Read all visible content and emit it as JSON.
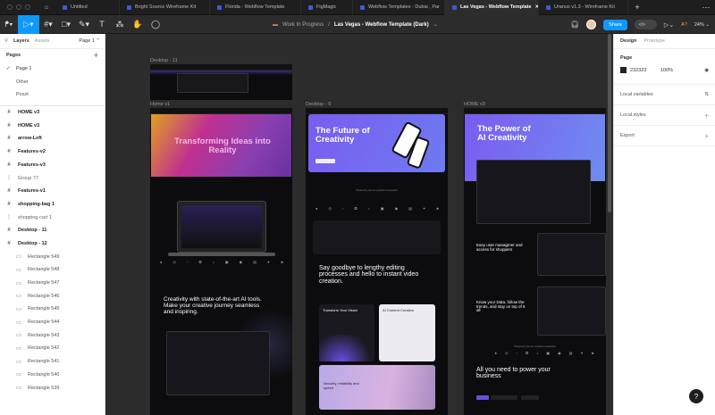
{
  "tabs": [
    {
      "label": "Untitled",
      "active": false
    },
    {
      "label": "Bright Source Wireframe Kit",
      "active": false
    },
    {
      "label": "Florida - Webflow Template",
      "active": false
    },
    {
      "label": "FigMagic",
      "active": false
    },
    {
      "label": "Webflow Templates - Dubai , Par",
      "active": false
    },
    {
      "label": "Las Vegas - Webflow Template",
      "active": true
    },
    {
      "label": "Uranus v1.3 - Wireframe Kit",
      "active": false
    }
  ],
  "toolbar": {
    "project": "Work In Progress",
    "separator": "/",
    "file": "Las Vegas - Webflow Template (Dark)",
    "share": "Share",
    "zoom": "24%",
    "dev_mode": "</>",
    "warning": "A?"
  },
  "left_panel": {
    "tabs": [
      "Layers",
      "Assets"
    ],
    "page_selector": "Page 1",
    "pages_title": "Pages",
    "pages": [
      "Page 1",
      "Other",
      "Poszt"
    ],
    "layers": [
      {
        "name": "HOME v3",
        "type": "frame"
      },
      {
        "name": "HOME v3",
        "type": "frame"
      },
      {
        "name": "arrow-Left",
        "type": "frame"
      },
      {
        "name": "Features-v2",
        "type": "frame"
      },
      {
        "name": "Features-v3",
        "type": "frame"
      },
      {
        "name": "Group 77",
        "type": "group"
      },
      {
        "name": "Features-v1",
        "type": "frame"
      },
      {
        "name": "shopping-bag 1",
        "type": "frame"
      },
      {
        "name": "shopping-cart 1",
        "type": "group"
      },
      {
        "name": "Desktop - 11",
        "type": "frame"
      },
      {
        "name": "Desktop - 12",
        "type": "frame"
      },
      {
        "name": "Rectangle 549",
        "type": "rect"
      },
      {
        "name": "Rectangle 548",
        "type": "rect"
      },
      {
        "name": "Rectangle 547",
        "type": "rect"
      },
      {
        "name": "Rectangle 546",
        "type": "rect"
      },
      {
        "name": "Rectangle 545",
        "type": "rect"
      },
      {
        "name": "Rectangle 544",
        "type": "rect"
      },
      {
        "name": "Rectangle 543",
        "type": "rect"
      },
      {
        "name": "Rectangle 542",
        "type": "rect"
      },
      {
        "name": "Rectangle 541",
        "type": "rect"
      },
      {
        "name": "Rectangle 540",
        "type": "rect"
      },
      {
        "name": "Rectangle 539",
        "type": "rect"
      }
    ]
  },
  "right_panel": {
    "tabs": [
      "Design",
      "Prototype"
    ],
    "page_title": "Page",
    "page_color": "232323",
    "page_opacity": "100%",
    "local_variables": "Local variables",
    "local_styles": "Local styles",
    "export": "Export"
  },
  "canvas": {
    "frames": {
      "desktop11": {
        "label": "Desktop - 11"
      },
      "home_v1": {
        "label": "Home v1",
        "hero": "Transforming Ideas into Reality",
        "section": "Creativity with state-of-the-art AI tools. Make your creative journey seamless and inspiring."
      },
      "desktop9": {
        "label": "Desktop - 9",
        "hero": "The Future of Creativity",
        "trusted": "Trusted by top tier product companies",
        "section": "Say goodbye to lengthy editing processes and hello to instant video creation.",
        "card1": "Transform Your Vision",
        "card2": "AI Content Creation",
        "card3": "Security, reliability and speed"
      },
      "home_v3": {
        "label": "HOME v3",
        "hero": "The Power of AI Creativity",
        "feature1": "Easy user managmer and access for shoppers",
        "feature2": "Know your Data, follow the trends, and stay on top of it all",
        "trusted": "Trusted by top tier product companies",
        "section": "All you need to power your business"
      }
    }
  },
  "help": "?"
}
